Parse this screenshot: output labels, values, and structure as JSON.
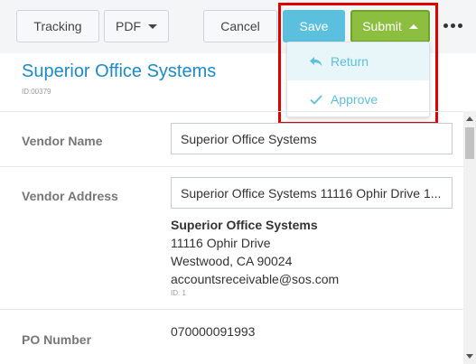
{
  "toolbar": {
    "tracking_label": "Tracking",
    "pdf_label": "PDF",
    "cancel_label": "Cancel",
    "save_label": "Save",
    "submit_label": "Submit"
  },
  "submit_menu": {
    "items": [
      {
        "label": "Return",
        "icon": "reply-icon"
      },
      {
        "label": "Approve",
        "icon": "check-icon"
      }
    ]
  },
  "header": {
    "title": "Superior Office Systems",
    "id": "ID:00379"
  },
  "form": {
    "vendor_name_label": "Vendor Name",
    "vendor_name_value": "Superior Office Systems",
    "vendor_address_label": "Vendor Address",
    "vendor_address_value": "Superior Office Systems 11116 Ophir Drive 1...",
    "address_block": {
      "name": "Superior Office Systems",
      "street": "11116 Ophir Drive",
      "city_line": "Westwood, CA 90024",
      "email": "accountsreceivable@sos.com",
      "id_line": "ID:  1"
    },
    "po_number_label": "PO Number",
    "po_number_value": "070000091993"
  },
  "colors": {
    "accent": "#1a8ac8",
    "save": "#5bc0de",
    "submit": "#8cbf3f",
    "highlight": "#e00000"
  }
}
